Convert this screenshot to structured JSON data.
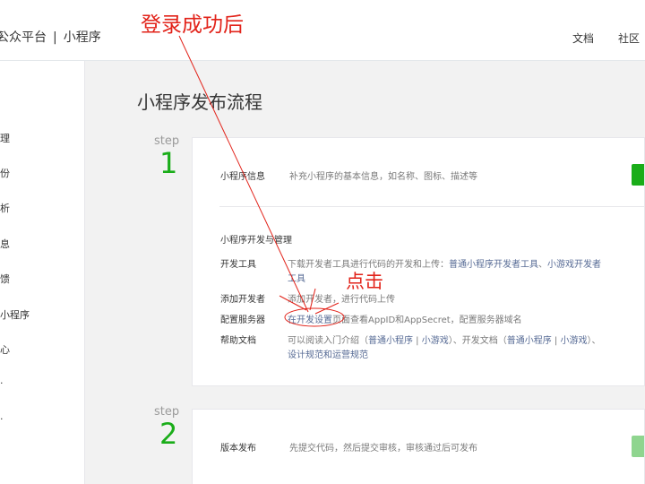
{
  "header": {
    "brand": "公众平台",
    "brand_prefix_fragment": "平",
    "separator": "|",
    "product": "小程序",
    "links": [
      "文档",
      "社区"
    ]
  },
  "sidebar": {
    "items": [
      "理",
      "份",
      "析",
      "息",
      "馈",
      "小程序",
      "心",
      "·",
      "·"
    ]
  },
  "main": {
    "title": "小程序发布流程",
    "step_word": "step",
    "step1": {
      "number": "1",
      "info_label": "小程序信息",
      "info_desc": "补充小程序的基本信息，如名称、图标、描述等",
      "dev_section": "小程序开发与管理",
      "tools_label": "开发工具",
      "tools_desc": "下载开发者工具进行代码的开发和上传：",
      "tools_link1": "普通小程序开发者工具",
      "tools_sep": "、",
      "tools_link2": "小游戏开发者",
      "tools_link2_wrap": "工具",
      "add_dev_label": "添加开发者",
      "add_dev_desc": "添加开发者，进行代码上传",
      "server_label": "配置服务器",
      "server_link": "在开发设置",
      "server_desc": "页面查看AppID和AppSecret，配置服务器域名",
      "help_label": "帮助文档",
      "help_desc_a": "可以阅读入门介绍（",
      "help_link_a1": "普通小程序",
      "help_bar": " | ",
      "help_link_a2": "小游戏",
      "help_desc_b": "）、开发文档（",
      "help_link_b1": "普通小程序",
      "help_link_b2": "小游戏",
      "help_desc_c": "）、",
      "help_link_c": "设计规范和运营规范"
    },
    "step2": {
      "number": "2",
      "label": "版本发布",
      "desc": "先提交代码，然后提交审核，审核通过后可发布"
    }
  },
  "annotations": {
    "login_note": "登录成功后",
    "click_note": "点击",
    "color": "#e2231a"
  },
  "colors": {
    "green": "#1aad19",
    "link": "#576b95"
  }
}
